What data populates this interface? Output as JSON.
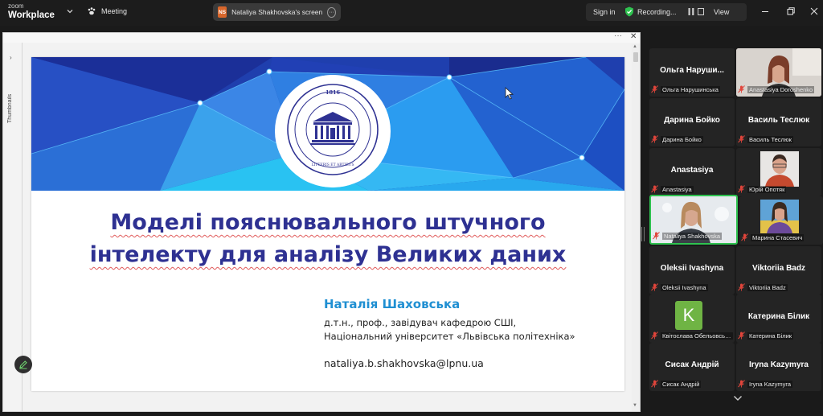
{
  "app": {
    "brand_top": "zoom",
    "brand_bottom": "Workplace",
    "meeting_label": "Meeting",
    "share_badge": "NS",
    "share_title": "Nataliya Shakhovska's screen",
    "sign_in": "Sign in",
    "recording": "Recording...",
    "view": "View"
  },
  "share": {
    "thumbnails_label": "Thumbnails"
  },
  "slide": {
    "title_line1": "Моделі пояснювального штучного",
    "title_line2": "інтелекту для аналізу Великих даних",
    "author": "Наталія Шаховська",
    "detail1": "д.т.н., проф., завідувач кафедрою СШІ,",
    "detail2": "Національний університет «Львівська політехніка»",
    "email": "nataliya.b.shakhovska@lpnu.ua",
    "emblem_text_outer": "НАЦІОНАЛЬНИЙ УНІВЕРСИТЕТ",
    "emblem_text_main": "ЛЬВІВСЬКА ПОЛІТЕХНІКА",
    "emblem_year": "1816",
    "emblem_motto": "LITTERIS ET ARTIBUS"
  },
  "participants": [
    {
      "name": "Ольга  Наруши...",
      "label": "Ольга Нарушинська",
      "video": false
    },
    {
      "name": "",
      "label": "Anastasiya Doroshenko",
      "video": true
    },
    {
      "name": "Дарина Бойко",
      "label": "Дарина Бойко",
      "video": false
    },
    {
      "name": "Василь Теслюк",
      "label": "Василь Теслюк",
      "video": false
    },
    {
      "name": "Anastasiya",
      "label": "Anastasiya",
      "video": false
    },
    {
      "name": "",
      "label": "Юрій Опотяк",
      "video": true
    },
    {
      "name": "",
      "label": "Nataliya Shakhovska",
      "video": true,
      "active": true
    },
    {
      "name": "",
      "label": "Марина Стасевич",
      "video": true
    },
    {
      "name": "Oleksii Ivashyna",
      "label": "Oleksii Ivashyna",
      "video": false
    },
    {
      "name": "Viktoriia Badz",
      "label": "Viktoriia Badz",
      "video": false
    },
    {
      "name": "",
      "label": "Квітослава Обельовськ...",
      "avatar_letter": "K",
      "video": false
    },
    {
      "name": "Катерина Білик",
      "label": "Катерина Білик",
      "video": false
    },
    {
      "name": "Сисак Андрій",
      "label": "Сисак Андрій",
      "video": false
    },
    {
      "name": "Iryna Kazymyra",
      "label": "Iryna Kazymyra",
      "video": false
    }
  ],
  "colors": {
    "title": "#2e3192",
    "author": "#1f8fd2",
    "active_speaker": "#2ec24f",
    "avatar_k": "#6fb444",
    "mic_muted": "#e0453b"
  }
}
